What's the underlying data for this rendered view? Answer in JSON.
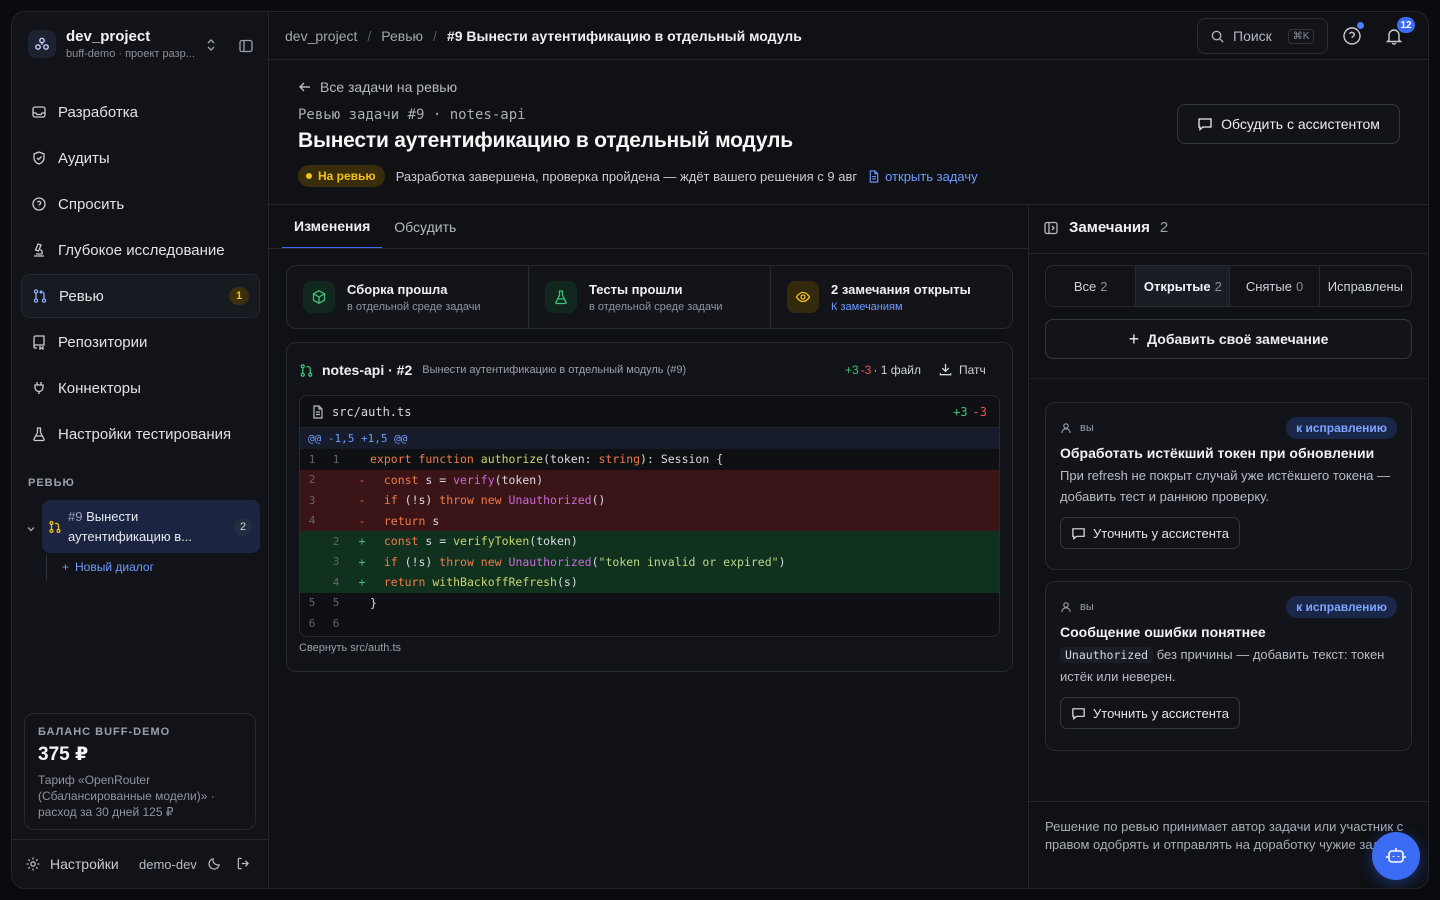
{
  "project": {
    "name": "dev_project",
    "subtitle": "buff-demo · проект разр..."
  },
  "nav": [
    {
      "label": "Разработка",
      "icon": "inbox-icon"
    },
    {
      "label": "Аудиты",
      "icon": "shield-icon"
    },
    {
      "label": "Спросить",
      "icon": "question-icon"
    },
    {
      "label": "Глубокое исследование",
      "icon": "microscope-icon"
    },
    {
      "label": "Ревью",
      "icon": "git-pull-request-icon",
      "badge": "1",
      "active": true
    },
    {
      "label": "Репозитории",
      "icon": "repository-icon"
    },
    {
      "label": "Коннекторы",
      "icon": "plug-icon"
    },
    {
      "label": "Настройки тестирования",
      "icon": "flask-icon"
    }
  ],
  "review_section": {
    "label": "РЕВЬЮ",
    "item_num": "#9",
    "item_title": "Вынести аутентификацию в...",
    "item_badge": "2",
    "new_dialog": "Новый диалог"
  },
  "balance": {
    "label": "БАЛАНС BUFF-DEMO",
    "value": "375 ₽",
    "desc": "Тариф «OpenRouter (Сбалансированные модели)» · расход за 30 дней 125 ₽"
  },
  "footer": {
    "settings": "Настройки",
    "user": "demo-dev"
  },
  "breadcrumbs": {
    "project": "dev_project",
    "section": "Ревью",
    "current": "#9 Вынести аутентификацию в отдельный модуль"
  },
  "search": {
    "label": "Поиск",
    "shortcut": "⌘K"
  },
  "notifications": {
    "count": "12"
  },
  "header": {
    "back": "Все задачи на ревью",
    "kicker": "Ревью задачи #9 · notes-api",
    "title": "Вынести аутентификацию в отдельный модуль",
    "status": "На ревью",
    "status_text": "Разработка завершена, проверка пройдена — ждёт вашего решения с 9 авг",
    "open_task": "открыть задачу",
    "discuss_button": "Обсудить с ассистентом"
  },
  "tabs": [
    "Изменения",
    "Обсудить"
  ],
  "checks": [
    {
      "title": "Сборка прошла",
      "sub": "в отдельной среде задачи",
      "icon": "box-icon"
    },
    {
      "title": "Тесты прошли",
      "sub": "в отдельной среде задачи",
      "icon": "flask-icon"
    },
    {
      "title": "2 замечания открыты",
      "sub": "К замечаниям",
      "icon": "eye-icon"
    }
  ],
  "diff": {
    "repo": "notes-api · #2",
    "desc": "Вынести аутентификацию в отдельный модуль (#9)",
    "added": "+3",
    "removed": "-3",
    "files": "· 1 файл",
    "patch": "Патч",
    "file": "src/auth.ts",
    "file_added": "+3",
    "file_removed": "-3",
    "hunk": "@@ -1,5 +1,5 @@",
    "collapse": "Свернуть src/auth.ts"
  },
  "notes_panel": {
    "title": "Замечания",
    "count": "2",
    "filters": [
      {
        "label": "Все",
        "n": "2"
      },
      {
        "label": "Открытые",
        "n": "2",
        "active": true
      },
      {
        "label": "Снятые",
        "n": "0"
      },
      {
        "label": "Исправлены",
        "n": ""
      }
    ],
    "add": "Добавить своё замечание",
    "notes": [
      {
        "author": "вы",
        "tag": "к исправлению",
        "title": "Обработать истёкший токен при обновлении",
        "body": "При refresh не покрыт случай уже истёкшего токена — добавить тест и раннюю проверку.",
        "button": "Уточнить у ассистента"
      },
      {
        "author": "вы",
        "tag": "к исправлению",
        "title": "Сообщение ошибки понятнее",
        "code": "Unauthorized",
        "body": " без причины — добавить текст: токен истёк или неверен.",
        "button": "Уточнить у ассистента"
      }
    ],
    "footer": "Решение по ревью принимает автор задачи или участник с правом одобрять и отправлять на доработку чужие задачи."
  },
  "colors": {
    "accent": "#3c6cf4",
    "warn": "#f3c21a",
    "add": "#3ec27a",
    "del": "#f0544f"
  }
}
